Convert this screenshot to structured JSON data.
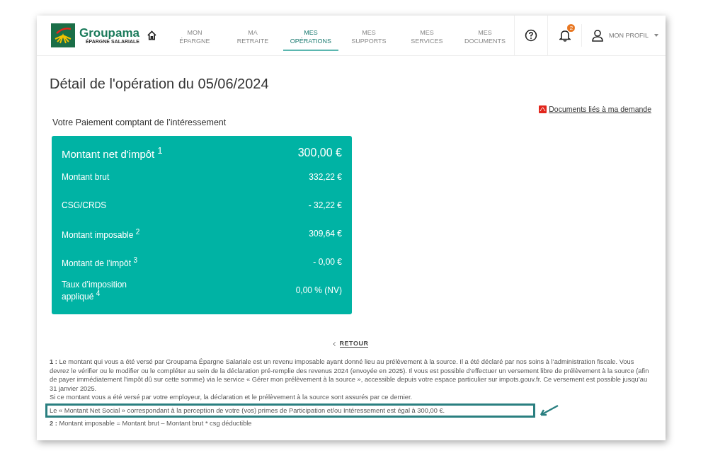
{
  "header": {
    "logo": {
      "name": "Groupama",
      "subtitle": "ÉPARGNE SALARIALE"
    },
    "nav": [
      {
        "lines": [
          "MON",
          "ÉPARGNE"
        ],
        "selected": false
      },
      {
        "lines": [
          "MA",
          "RETRAITE"
        ],
        "selected": false
      },
      {
        "lines": [
          "MES",
          "OPÉRATIONS"
        ],
        "selected": true
      },
      {
        "lines": [
          "MES",
          "SUPPORTS"
        ],
        "selected": false
      },
      {
        "lines": [
          "MES",
          "SERVICES"
        ],
        "selected": false
      },
      {
        "lines": [
          "MES",
          "DOCUMENTS"
        ],
        "selected": false
      }
    ],
    "notifications": {
      "badge": "2"
    },
    "profile": {
      "label": "MON PROFIL"
    }
  },
  "title": "Détail de l'opération du 05/06/2024",
  "documents_link": "Documents liés à ma demande",
  "section_title": "Votre Paiement comptant de l’intéressement",
  "summary": [
    {
      "label": "Montant net d'impôt $^{1}$",
      "value": "300,00 €",
      "kind": "main"
    },
    {
      "label": "Montant brut",
      "value": "332,22 €",
      "kind": "line"
    },
    {
      "label": "CSG/CRDS",
      "value": "- 32,22 €",
      "kind": "line"
    },
    {
      "label": "Montant imposable $^{2}$",
      "value": "309,64 €",
      "kind": "line"
    },
    {
      "label": "Montant de l’impôt $^{3}$",
      "value": "- 0,00 €",
      "kind": "line"
    },
    {
      "label": "Taux d’imposition appliqué $^{4}$",
      "value": "0,00 % (NV)",
      "kind": "line"
    }
  ],
  "back_link": "RETOUR",
  "footnotes": [
    {
      "text": "**1 :** Le montant qui vous a été versé par Groupama Épargne Salariale est un revenu imposable ayant donné lieu au prélèvement à la source. Il a été déclaré par nos soins à l’administration fiscale. Vous devrez le vérifier ou le modifier ou le compléter au sein de la déclaration pré-remplie des revenus 2024 (envoyée en 2025). Il vous est possible d’effectuer un versement libre de prélèvement à la source (afin de payer immédiatement l’impôt dû sur cette somme) via le service « Gérer mon prélèvement à la source », accessible depuis votre espace particulier sur impots.gouv.fr. Ce versement est possible jusqu’au 31 janvier 2025.",
      "highlighted": false
    },
    {
      "text": "Si ce montant vous a été versé par votre employeur, la déclaration et le prélèvement à la source sont assurés par ce dernier.",
      "highlighted": false
    },
    {
      "text": "Le « Montant Net Social » correspondant à la perception de votre (vos) primes de Participation et/ou Intéressement est égal à 300,00 €.",
      "highlighted": true
    },
    {
      "text": "**2 :** Montant imposable = Montant brut – Montant brut * csg déductible",
      "highlighted": false
    }
  ]
}
